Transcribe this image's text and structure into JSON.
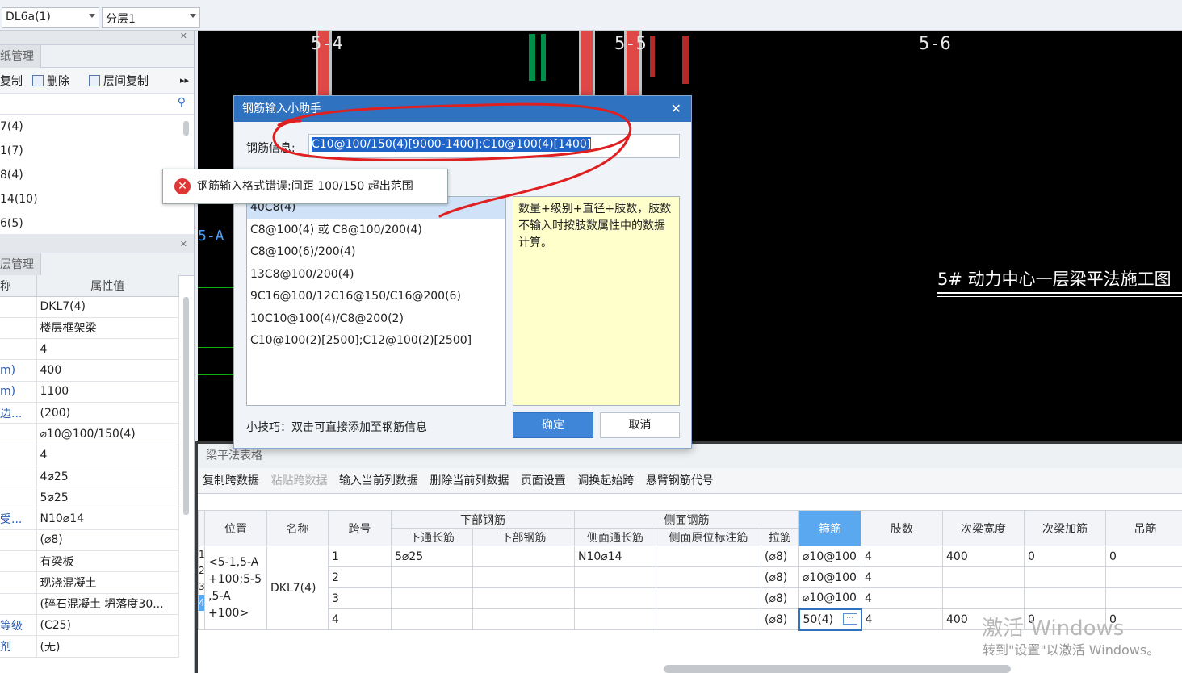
{
  "toolbar": {
    "combo1": "DL6a(1)",
    "combo2": "分层1"
  },
  "drawing_panel": {
    "tab": "纸管理",
    "tools": [
      "复制",
      "删除",
      "层间复制"
    ],
    "items": [
      "7(4)",
      "1(7)",
      "8(4)",
      "14(10)",
      "6(5)"
    ]
  },
  "attr_panel": {
    "tab": "层管理",
    "col_name": "称",
    "col_value": "属性值",
    "rows": [
      {
        "k": "",
        "v": "DKL7(4)"
      },
      {
        "k": "",
        "v": "楼层框架梁"
      },
      {
        "k": "",
        "v": "4"
      },
      {
        "k": "m)",
        "v": "400"
      },
      {
        "k": "m)",
        "v": "1100"
      },
      {
        "k": "边...",
        "v": "(200)"
      },
      {
        "k": "",
        "v": "⌀10@100/150(4)"
      },
      {
        "k": "",
        "v": "4"
      },
      {
        "k": "",
        "v": "4⌀25"
      },
      {
        "k": "",
        "v": "5⌀25"
      },
      {
        "k": "受...",
        "v": "N10⌀14"
      },
      {
        "k": "",
        "v": "(⌀8)"
      },
      {
        "k": "",
        "v": "有梁板"
      },
      {
        "k": "",
        "v": "现浇混凝土"
      },
      {
        "k": "",
        "v": "(碎石混凝土 坍落度30..."
      },
      {
        "k": "等级",
        "v": "(C25)"
      },
      {
        "k": "剂",
        "v": "(无)"
      }
    ]
  },
  "cad": {
    "axes": [
      "5-4",
      "5-5",
      "5-6"
    ],
    "left_axis": "5-A",
    "drawing_title": "5# 动力中心一层梁平法施工图"
  },
  "dialog": {
    "title": "钢筋输入小助手",
    "label": "钢筋信息:",
    "value": "C10@100/150(4)[9000-1400];C10@100(4)[1400]",
    "list": [
      "40C8(4)",
      "C8@100(4) 或 C8@100/200(4)",
      "C8@100(6)/200(4)",
      "13C8@100/200(4)",
      "9C16@100/12C16@150/C16@200(6)",
      "10C10@100(4)/C8@200(2)",
      "C10@100(2)[2500];C12@100(2)[2500]"
    ],
    "help": "数量+级别+直径+肢数，肢数不输入时按肢数属性中的数据计算。",
    "tip": "小技巧：双击可直接添加至钢筋信息",
    "ok": "确定",
    "cancel": "取消"
  },
  "error_tip": "钢筋输入格式错误:间距 100/150 超出范围",
  "table_panel": {
    "title": "梁平法表格",
    "tools": [
      "复制跨数据",
      "粘贴跨数据",
      "输入当前列数据",
      "删除当前列数据",
      "页面设置",
      "调换起始跨",
      "悬臂钢筋代号"
    ],
    "headers": {
      "pos": "位置",
      "name": "名称",
      "span": "跨号",
      "bottom_group": "下部钢筋",
      "bottom_through": "下通长筋",
      "bottom_bar": "下部钢筋",
      "side_group": "侧面钢筋",
      "side_through": "侧面通长筋",
      "side_note": "侧面原位标注筋",
      "tie": "拉筋",
      "stirrup": "箍筋",
      "legs": "肢数",
      "sec_width": "次梁宽度",
      "sec_add": "次梁加筋",
      "hanger": "吊筋"
    },
    "position_text": "<5-1,5-A +100;5-5 ,5-A +100>",
    "row_numbers": [
      "1",
      "2",
      "3",
      "4"
    ],
    "beam_name": "DKL7(4)",
    "rows": [
      {
        "span": "1",
        "bottom_through": "5⌀25",
        "bottom": "",
        "side_through": "N10⌀14",
        "side_note": "",
        "tie": "(⌀8)",
        "stirrup": "⌀10@100",
        "legs": "4",
        "sec_width": "400",
        "sec_add": "0",
        "hanger": "0"
      },
      {
        "span": "2",
        "bottom_through": "",
        "bottom": "",
        "side_through": "",
        "side_note": "",
        "tie": "(⌀8)",
        "stirrup": "⌀10@100",
        "legs": "4",
        "sec_width": "",
        "sec_add": "",
        "hanger": ""
      },
      {
        "span": "3",
        "bottom_through": "",
        "bottom": "",
        "side_through": "",
        "side_note": "",
        "tie": "(⌀8)",
        "stirrup": "⌀10@100",
        "legs": "4",
        "sec_width": "",
        "sec_add": "",
        "hanger": ""
      },
      {
        "span": "4",
        "bottom_through": "",
        "bottom": "",
        "side_through": "",
        "side_note": "",
        "tie": "(⌀8)",
        "stirrup": "50(4)",
        "legs": "4",
        "sec_width": "400",
        "sec_add": "0",
        "hanger": "0"
      }
    ]
  },
  "watermark": {
    "line1": "激活 Windows",
    "line2": "转到\"设置\"以激活 Windows。"
  }
}
